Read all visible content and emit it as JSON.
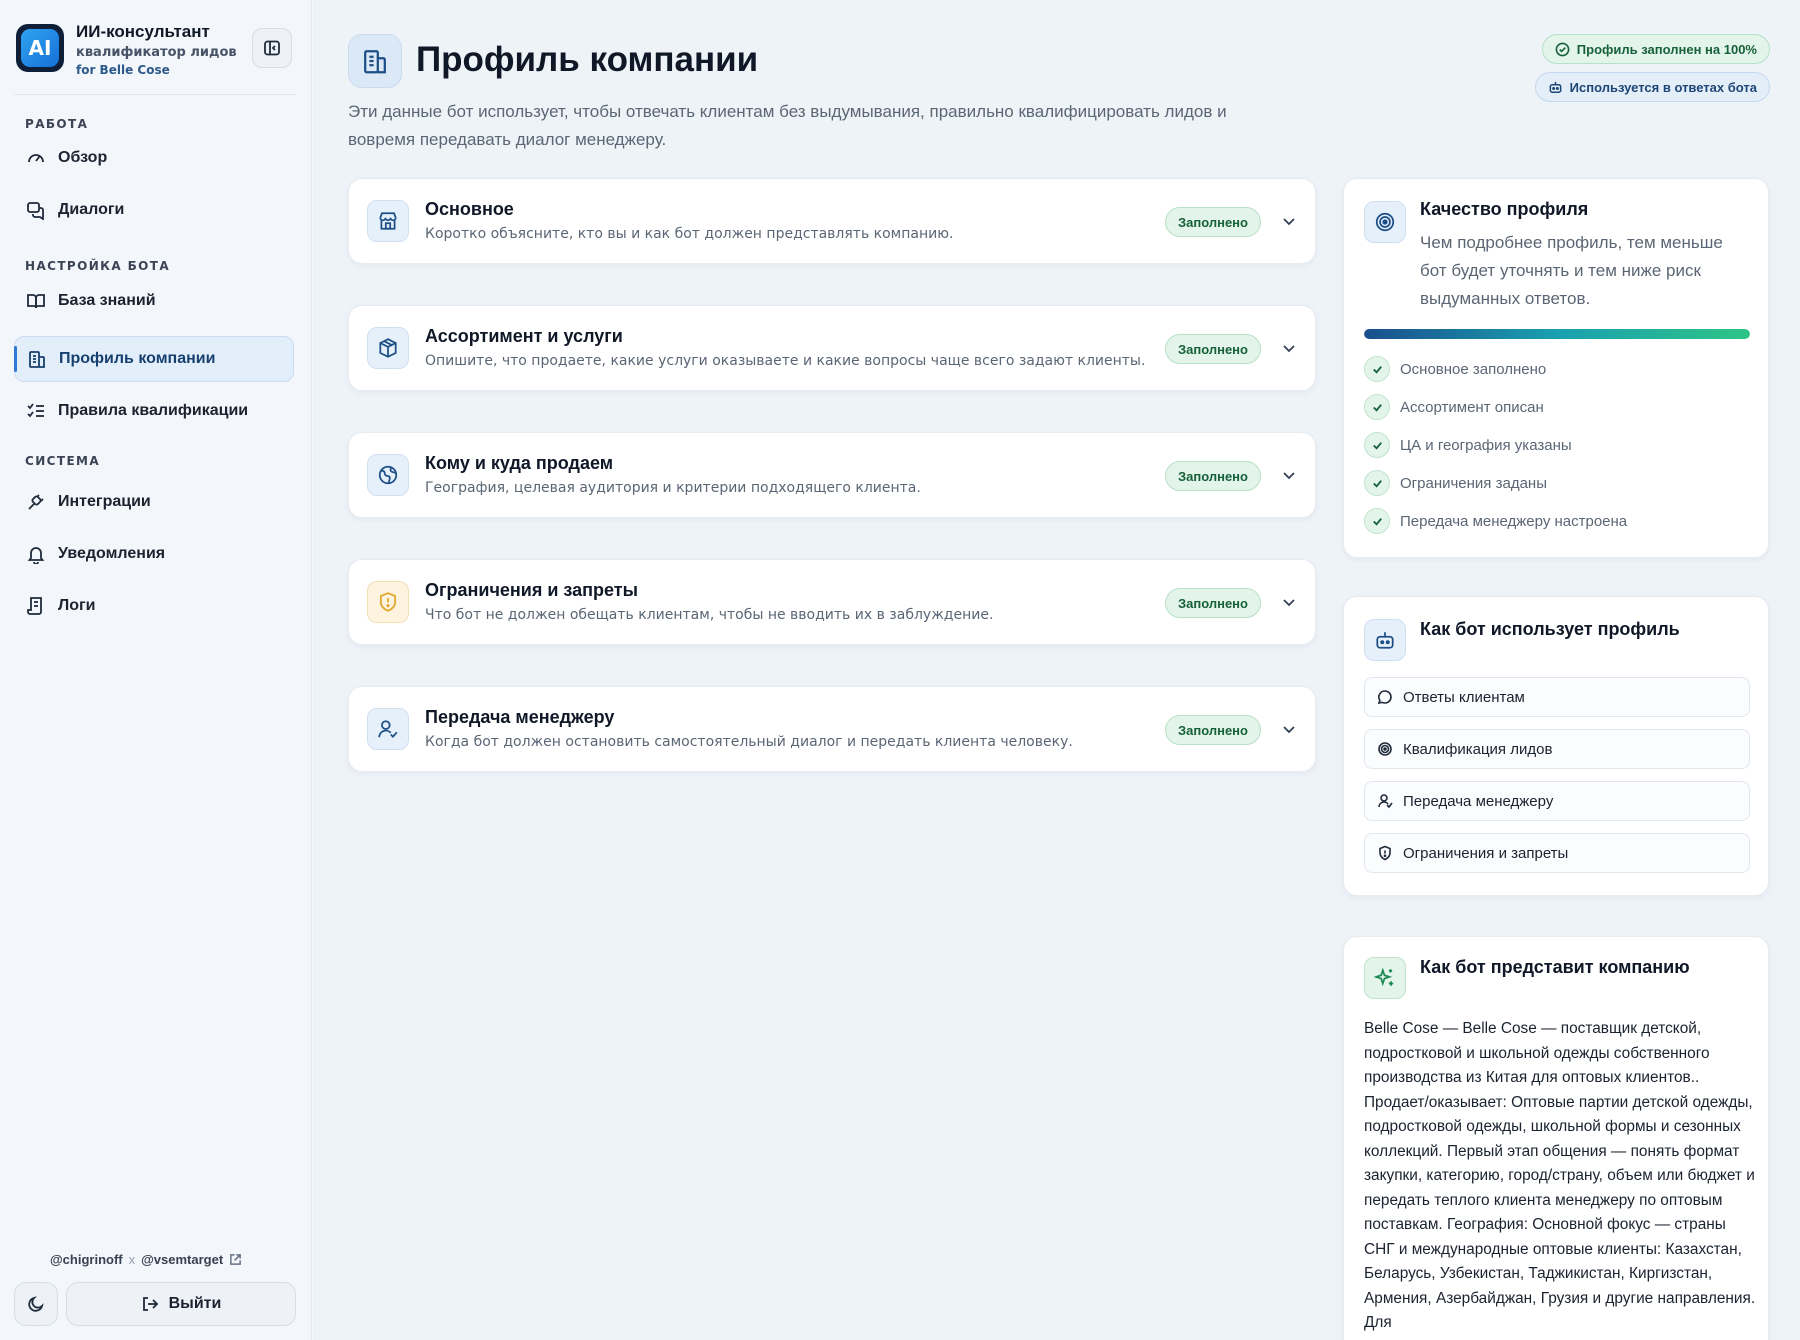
{
  "sidebar": {
    "app_title": "ИИ-консультант",
    "app_subtitle": "квалификатор лидов",
    "app_client": "for Belle Cose",
    "logo_text": "AI",
    "sections": [
      "РАБОТА",
      "НАСТРОЙКА БОТА",
      "СИСТЕМА"
    ],
    "items": [
      {
        "label": "Обзор",
        "icon": "gauge-icon"
      },
      {
        "label": "Диалоги",
        "icon": "chat-icon"
      },
      {
        "label": "База знаний",
        "icon": "book-icon"
      },
      {
        "label": "Профиль компании",
        "icon": "building-icon",
        "active": true
      },
      {
        "label": "Правила квалификации",
        "icon": "list-check-icon"
      },
      {
        "label": "Интеграции",
        "icon": "plug-icon"
      },
      {
        "label": "Уведомления",
        "icon": "bell-icon"
      },
      {
        "label": "Логи",
        "icon": "scroll-icon"
      }
    ],
    "credit_a": "@chigrinoff",
    "credit_x": "x",
    "credit_b": "@vsemtarget",
    "logout_label": "Выйти"
  },
  "header": {
    "title": "Профиль компании",
    "description": "Эти данные бот использует, чтобы отвечать клиентам без выдумывания, правильно квалифицировать лидов и вовремя передавать диалог менеджеру.",
    "badge_filled": "Профиль заполнен на 100%",
    "badge_used": "Используется в ответах бота"
  },
  "sections": [
    {
      "title": "Основное",
      "desc": "Коротко объясните, кто вы и как бот должен представлять компанию.",
      "status": "Заполнено",
      "icon": "store-icon"
    },
    {
      "title": "Ассортимент и услуги",
      "desc": "Опишите, что продаете, какие услуги оказываете и какие вопросы чаще всего задают клиенты.",
      "status": "Заполнено",
      "icon": "box-icon"
    },
    {
      "title": "Кому и куда продаем",
      "desc": "География, целевая аудитория и критерии подходящего клиента.",
      "status": "Заполнено",
      "icon": "globe-icon"
    },
    {
      "title": "Ограничения и запреты",
      "desc": "Что бот не должен обещать клиентам, чтобы не вводить их в заблуждение.",
      "status": "Заполнено",
      "icon": "shield-warning-icon"
    },
    {
      "title": "Передача менеджеру",
      "desc": "Когда бот должен остановить самостоятельный диалог и передать клиента человеку.",
      "status": "Заполнено",
      "icon": "user-check-icon"
    }
  ],
  "quality": {
    "title": "Качество профиля",
    "desc": "Чем подробнее профиль, тем меньше бот будет уточнять и тем ниже риск выдуманных ответов.",
    "progress": 1.0,
    "checks": [
      "Основное заполнено",
      "Ассортимент описан",
      "ЦА и география указаны",
      "Ограничения заданы",
      "Передача менеджеру настроена"
    ]
  },
  "usage": {
    "title": "Как бот использует профиль",
    "items": [
      {
        "label": "Ответы клиентам",
        "icon": "message-icon"
      },
      {
        "label": "Квалификация лидов",
        "icon": "target-icon"
      },
      {
        "label": "Передача менеджеру",
        "icon": "user-icon"
      },
      {
        "label": "Ограничения и запреты",
        "icon": "shield-icon"
      }
    ]
  },
  "presentation": {
    "title": "Как бот представит компанию",
    "text": "Belle Cose — Belle Cose — поставщик детской, подростковой и школьной одежды собственного производства из Китая для оптовых клиентов.. Продает/оказывает: Оптовые партии детской одежды, подростковой одежды, школьной формы и сезонных коллекций. Первый этап общения — понять формат закупки, категорию, город/страну, объем или бюджет и передать теплого клиента менеджеру по оптовым поставкам. География: Основной фокус — страны СНГ и международные оптовые клиенты: Казахстан, Беларусь, Узбекистан, Таджикистан, Киргизстан, Армения, Азербайджан, Грузия и другие направления. Для"
  },
  "colors": {
    "accent": "#2e7ad6",
    "success": "#17613a",
    "success_bg": "#e3f4ea",
    "warning": "#e2a52b"
  }
}
